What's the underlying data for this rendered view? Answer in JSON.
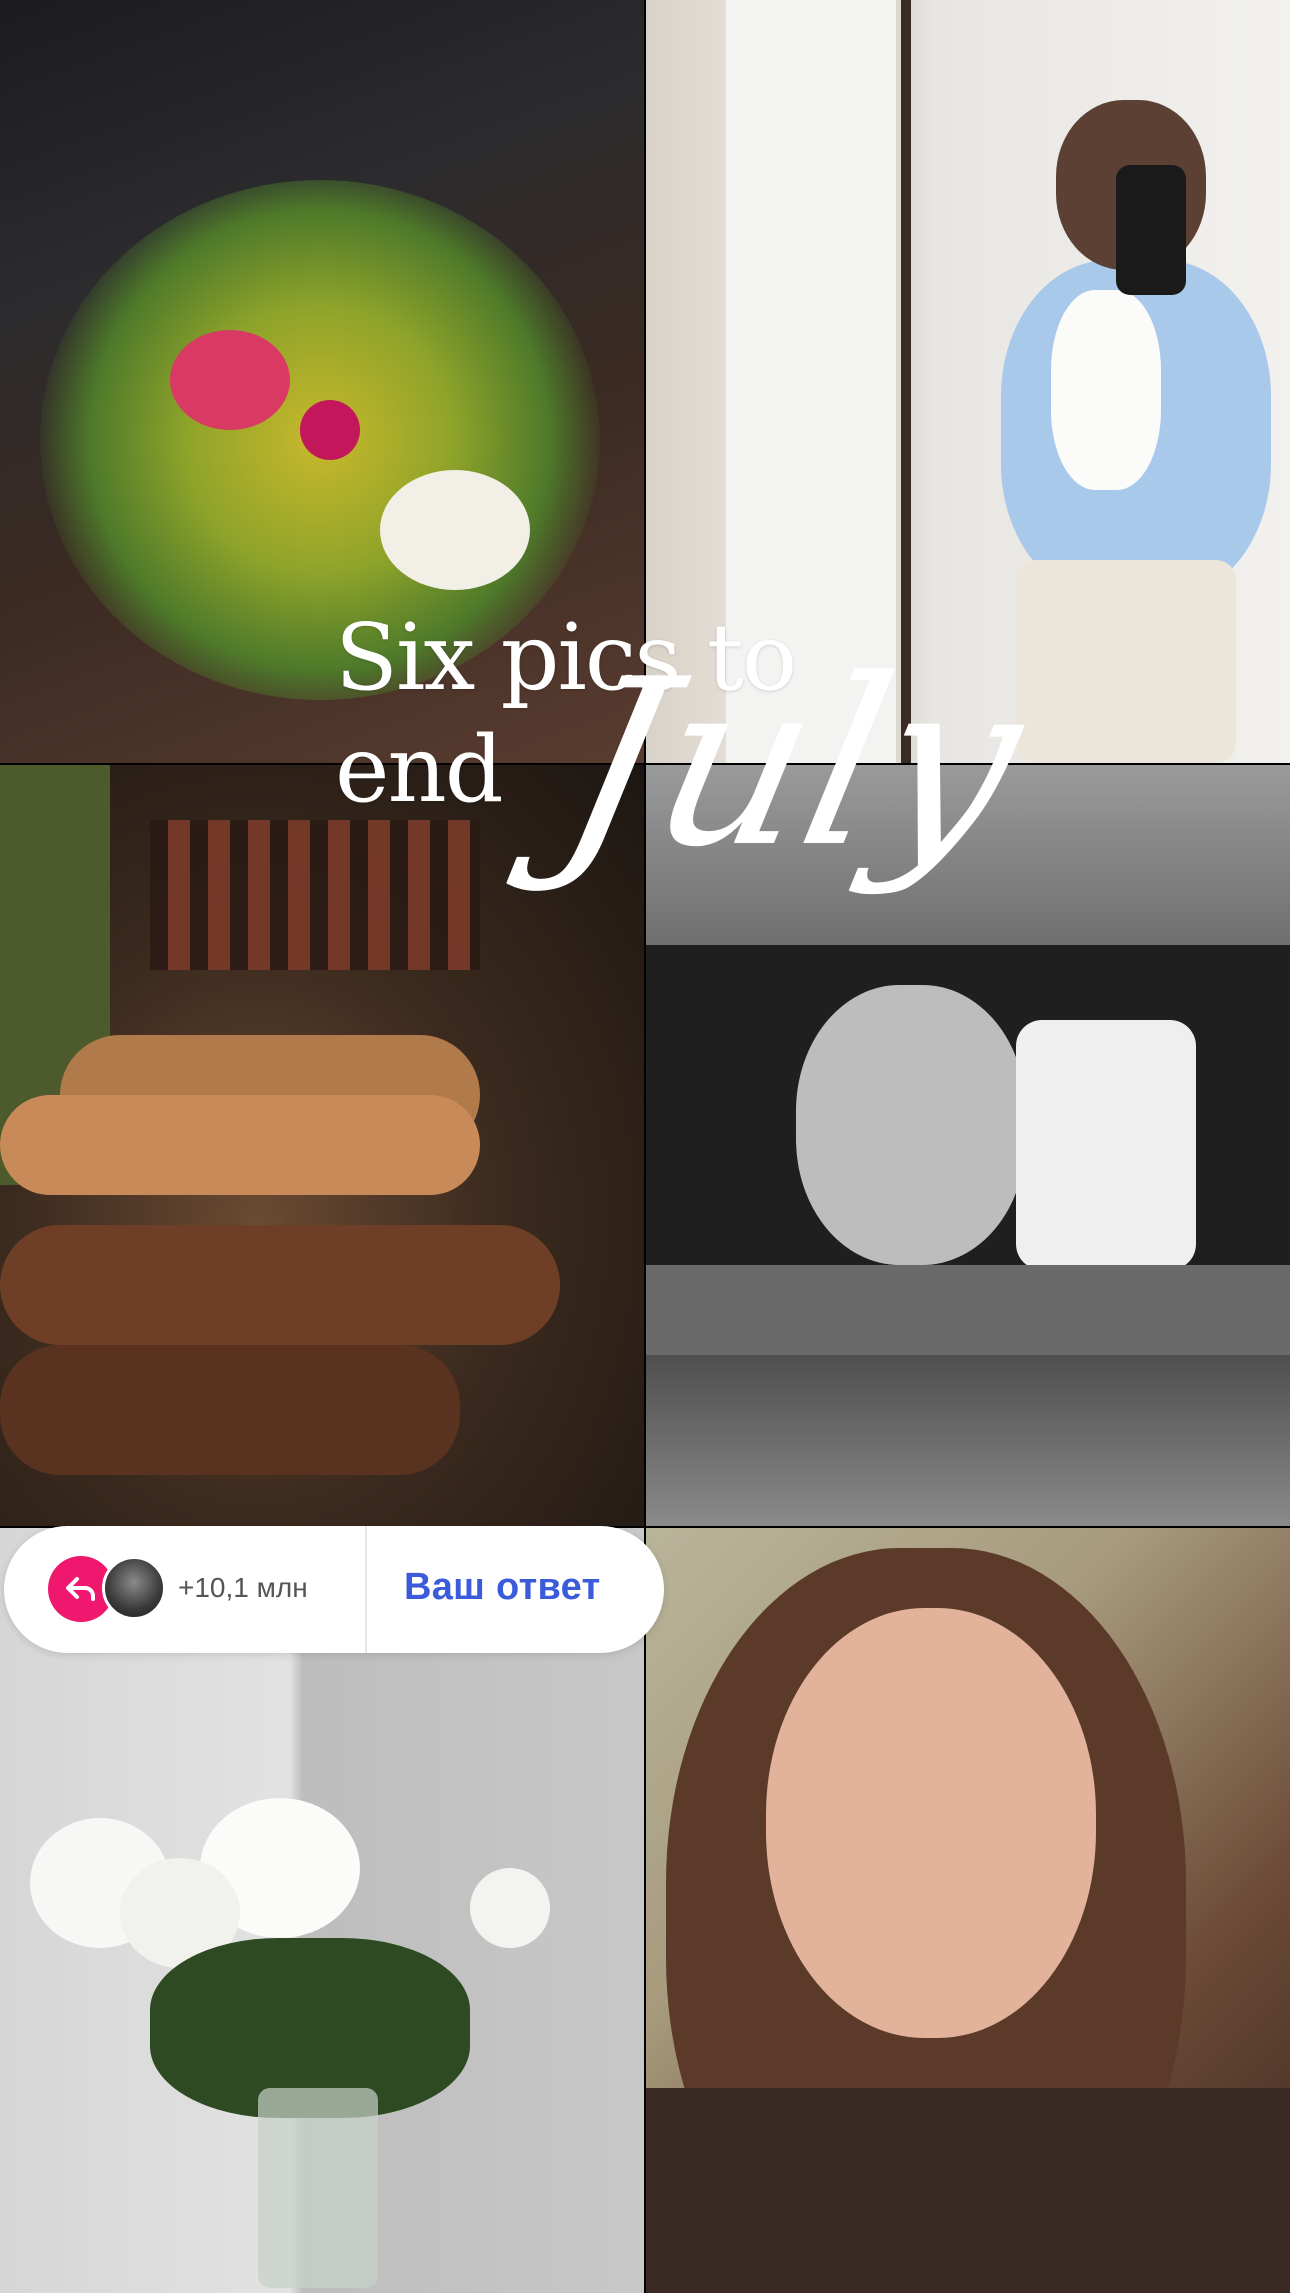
{
  "title": {
    "line1": "Six pics to",
    "line2": "end",
    "script": "July"
  },
  "photos": [
    {
      "name": "bouquet-in-car"
    },
    {
      "name": "mirror-selfie-blue-shirt"
    },
    {
      "name": "barbecue-skewers"
    },
    {
      "name": "car-mirror-selfie-bw"
    },
    {
      "name": "white-flowers-vase"
    },
    {
      "name": "portrait-selfie"
    }
  ],
  "reply": {
    "icon": "reply-arrow-icon",
    "count": "+10,1 млн",
    "action": "Ваш ответ",
    "accent": "#f0186e",
    "action_color": "#3b5bdb"
  }
}
